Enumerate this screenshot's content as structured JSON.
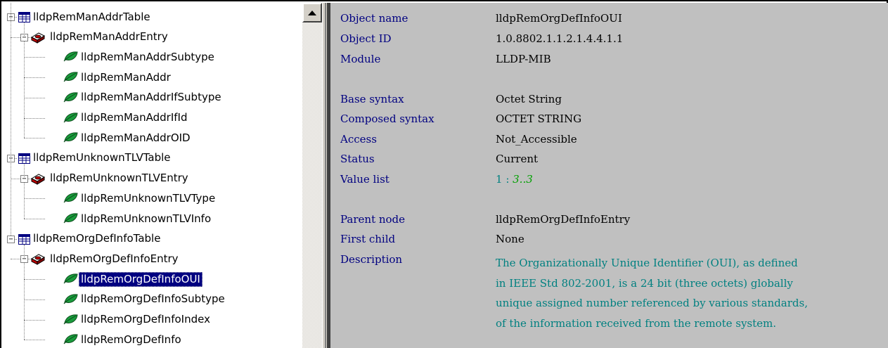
{
  "tree": {
    "nodes": [
      {
        "label": "lldpRemManAddrTable",
        "kind": "table"
      },
      {
        "label": "lldpRemManAddrEntry",
        "kind": "entry"
      },
      {
        "label": "lldpRemManAddrSubtype",
        "kind": "leaf"
      },
      {
        "label": "lldpRemManAddr",
        "kind": "leaf"
      },
      {
        "label": "lldpRemManAddrIfSubtype",
        "kind": "leaf"
      },
      {
        "label": "lldpRemManAddrIfId",
        "kind": "leaf"
      },
      {
        "label": "lldpRemManAddrOID",
        "kind": "leaf"
      },
      {
        "label": "lldpRemUnknownTLVTable",
        "kind": "table"
      },
      {
        "label": "lldpRemUnknownTLVEntry",
        "kind": "entry"
      },
      {
        "label": "lldpRemUnknownTLVType",
        "kind": "leaf"
      },
      {
        "label": "lldpRemUnknownTLVInfo",
        "kind": "leaf"
      },
      {
        "label": "lldpRemOrgDefInfoTable",
        "kind": "table"
      },
      {
        "label": "lldpRemOrgDefInfoEntry",
        "kind": "entry"
      },
      {
        "label": "lldpRemOrgDefInfoOUI",
        "kind": "leaf",
        "selected": true
      },
      {
        "label": "lldpRemOrgDefInfoSubtype",
        "kind": "leaf"
      },
      {
        "label": "lldpRemOrgDefInfoIndex",
        "kind": "leaf"
      },
      {
        "label": "lldpRemOrgDefInfo",
        "kind": "leaf"
      }
    ],
    "expander_symbol": "−"
  },
  "details": {
    "object_name": {
      "label": "Object name",
      "value": "lldpRemOrgDefInfoOUI"
    },
    "object_id": {
      "label": "Object ID",
      "value": "1.0.8802.1.1.2.1.4.4.1.1"
    },
    "module": {
      "label": "Module",
      "value": "LLDP-MIB"
    },
    "base_syntax": {
      "label": "Base syntax",
      "value": "Octet String"
    },
    "composed_syntax": {
      "label": "Composed syntax",
      "value": "OCTET STRING"
    },
    "access": {
      "label": "Access",
      "value": "Not_Accessible"
    },
    "status": {
      "label": "Status",
      "value": "Current"
    },
    "value_list": {
      "label": "Value list",
      "index": "1",
      "separator": " : ",
      "range": "3..3"
    },
    "parent_node": {
      "label": "Parent node",
      "value": "lldpRemOrgDefInfoEntry"
    },
    "first_child": {
      "label": "First child",
      "value": "None"
    },
    "description": {
      "label": "Description",
      "lines": [
        "The Organizationally Unique Identifier (OUI), as defined",
        "in IEEE Std 802-2001, is a 24 bit (three octets) globally",
        "unique assigned number referenced by various standards,",
        "of the information received from the remote system."
      ]
    }
  },
  "colors": {
    "label_color": "#000080",
    "description_color": "#008080",
    "range_color": "#00a000",
    "selection_bg": "#000080",
    "pane_bg": "#c0c0c0"
  },
  "icons": {
    "table": "table-icon",
    "entry": "entry-icon",
    "leaf": "leaf-icon",
    "scroll_up": "scroll-up-arrow-icon"
  }
}
